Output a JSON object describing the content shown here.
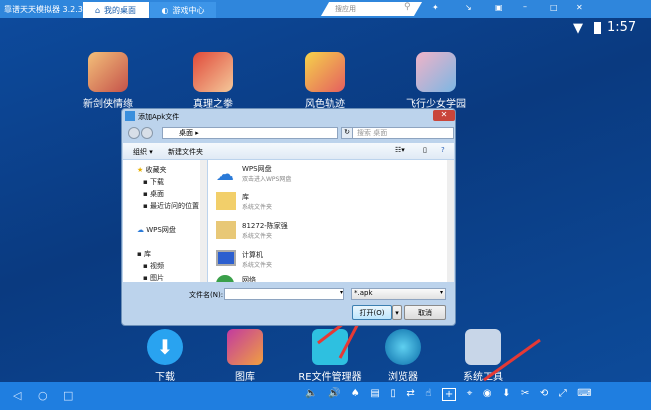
{
  "titlebar": {
    "app_title": "靠谱天天模拟器 3.2.3",
    "tabs": [
      {
        "label": "我的桌面",
        "active": true
      },
      {
        "label": "游戏中心",
        "active": false
      }
    ],
    "search_placeholder": "搜应用"
  },
  "statusbar": {
    "time": "1:57"
  },
  "desktop_apps": [
    {
      "label": "新剑侠情缘"
    },
    {
      "label": "真理之拳"
    },
    {
      "label": "风色轨迹"
    },
    {
      "label": "飞行少女学园"
    }
  ],
  "dock_apps": [
    {
      "label": "下载"
    },
    {
      "label": "图库"
    },
    {
      "label": "RE文件管理器"
    },
    {
      "label": "浏览器"
    },
    {
      "label": "系统工具"
    }
  ],
  "dialog": {
    "title": "添加Apk文件",
    "path": "桌面",
    "search_placeholder": "搜索 桌面",
    "organize": "组织 ▾",
    "new_folder": "新建文件夹",
    "nav": [
      {
        "label": "收藏夹",
        "group": true
      },
      {
        "label": "下载"
      },
      {
        "label": "桌面"
      },
      {
        "label": "最近访问的位置"
      },
      {
        "label": "WPS网盘",
        "group": true
      },
      {
        "label": "库",
        "group": true
      },
      {
        "label": "视频"
      },
      {
        "label": "图片"
      }
    ],
    "files": [
      {
        "name": "WPS网盘",
        "desc": "双击进入WPS网盘"
      },
      {
        "name": "库",
        "desc": "系统文件夹"
      },
      {
        "name": "81272-陈家强",
        "desc": "系统文件夹"
      },
      {
        "name": "计算机",
        "desc": "系统文件夹"
      },
      {
        "name": "网络",
        "desc": ""
      }
    ],
    "filename_label": "文件名(N):",
    "filename_value": "",
    "filter": "*.apk",
    "open": "打开(O)",
    "cancel": "取消"
  },
  "colors": {
    "titlebar": "#2f86dc",
    "dock": "#1f7ee0",
    "annotation_arrow": "#e53935"
  }
}
